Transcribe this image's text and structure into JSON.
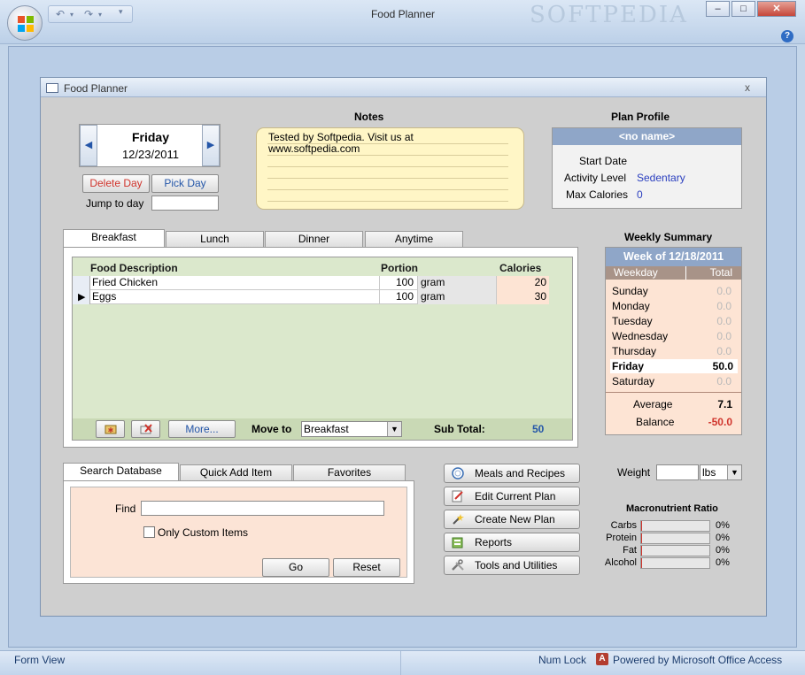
{
  "app": {
    "title": "Food Planner",
    "watermark": "SOFTPEDIA",
    "help": "?"
  },
  "window_controls": {
    "minimize": "–",
    "maximize": "□",
    "close": "✕"
  },
  "form": {
    "title": "Food Planner",
    "close": "x"
  },
  "day": {
    "name": "Friday",
    "date": "12/23/2011",
    "prev_icon": "left-arrow-icon",
    "next_icon": "right-arrow-icon",
    "delete_label": "Delete Day",
    "pick_label": "Pick Day",
    "jump_label": "Jump to day",
    "jump_value": ""
  },
  "notes": {
    "heading": "Notes",
    "text": "Tested by Softpedia. Visit us at\nwww.softpedia.com"
  },
  "profile": {
    "heading": "Plan Profile",
    "name": "<no name>",
    "start_date_label": "Start Date",
    "start_date_value": "",
    "activity_label": "Activity Level",
    "activity_value": "Sedentary",
    "max_cal_label": "Max Calories",
    "max_cal_value": "0"
  },
  "meal_tabs": [
    {
      "label": "Breakfast"
    },
    {
      "label": "Lunch"
    },
    {
      "label": "Dinner"
    },
    {
      "label": "Anytime"
    }
  ],
  "grid": {
    "columns": [
      "Food Description",
      "Portion",
      "Calories"
    ],
    "rows": [
      {
        "food": "Fried Chicken",
        "qty": "100",
        "unit": "gram",
        "cal": "20",
        "current": false
      },
      {
        "food": "Eggs",
        "qty": "100",
        "unit": "gram",
        "cal": "30",
        "current": true
      }
    ],
    "more_label": "More...",
    "move_to_label": "Move to",
    "move_to_value": "Breakfast",
    "subtotal_label": "Sub Total:",
    "subtotal_value": "50"
  },
  "weekly": {
    "heading": "Weekly Summary",
    "week_label": "Week of",
    "week_date": "12/18/2011",
    "col_weekday": "Weekday",
    "col_total": "Total",
    "days": [
      {
        "day": "Sunday",
        "total": "0.0"
      },
      {
        "day": "Monday",
        "total": "0.0"
      },
      {
        "day": "Tuesday",
        "total": "0.0"
      },
      {
        "day": "Wednesday",
        "total": "0.0"
      },
      {
        "day": "Thursday",
        "total": "0.0"
      },
      {
        "day": "Friday",
        "total": "50.0"
      },
      {
        "day": "Saturday",
        "total": "0.0"
      }
    ],
    "average_label": "Average",
    "average_value": "7.1",
    "balance_label": "Balance",
    "balance_value": "-50.0"
  },
  "search_tabs": [
    {
      "label": "Search Database"
    },
    {
      "label": "Quick Add Item"
    },
    {
      "label": "Favorites"
    }
  ],
  "search": {
    "find_label": "Find",
    "find_value": "",
    "custom_label": "Only Custom Items",
    "go_label": "Go",
    "reset_label": "Reset"
  },
  "actions": [
    {
      "label": "Meals and Recipes",
      "icon": "meals-icon"
    },
    {
      "label": "Edit Current Plan",
      "icon": "edit-plan-icon"
    },
    {
      "label": "Create New Plan",
      "icon": "new-plan-icon"
    },
    {
      "label": "Reports",
      "icon": "reports-icon"
    },
    {
      "label": "Tools and Utilities",
      "icon": "tools-icon"
    }
  ],
  "weight": {
    "label": "Weight",
    "value": "",
    "unit": "lbs"
  },
  "macros": {
    "heading": "Macronutrient Ratio",
    "items": [
      {
        "label": "Carbs",
        "pct": "0%"
      },
      {
        "label": "Protein",
        "pct": "0%"
      },
      {
        "label": "Fat",
        "pct": "0%"
      },
      {
        "label": "Alcohol",
        "pct": "0%"
      }
    ]
  },
  "status": {
    "left": "Form View",
    "numlock": "Num Lock",
    "powered": "Powered by Microsoft Office Access"
  }
}
